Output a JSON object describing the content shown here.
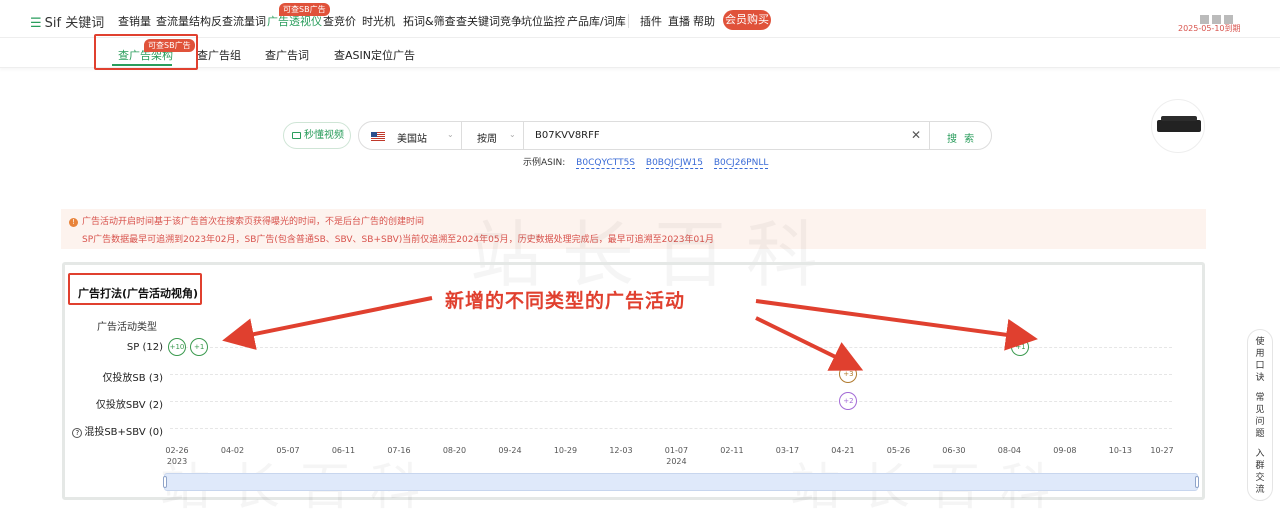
{
  "header": {
    "logo_mark": "☰",
    "logo_text": "Sif 关键词",
    "nav": [
      {
        "label": "查销量"
      },
      {
        "label": "查流量结构"
      },
      {
        "label": "反查流量词"
      },
      {
        "label": "广告透视仪",
        "active": true,
        "badge": "可查SB广告"
      },
      {
        "label": "查竞价"
      },
      {
        "label": "时光机"
      },
      {
        "label": "拓词&筛查"
      },
      {
        "label": "查关键词竞争"
      },
      {
        "label": "坑位监控"
      },
      {
        "label": "产品库/词库"
      },
      {
        "label": "插件"
      },
      {
        "label": "直播"
      },
      {
        "label": "帮助"
      }
    ],
    "buy_label": "会员购买",
    "expire_text": "2025-05-10到期"
  },
  "subnav": {
    "tabs": [
      {
        "label": "查广告架构",
        "active": true,
        "badge": "可查SB广告"
      },
      {
        "label": "查广告组"
      },
      {
        "label": "查广告词"
      },
      {
        "label": "查ASIN定位广告"
      }
    ]
  },
  "search": {
    "video_label": "秒懂视频",
    "site": "美国站",
    "period": "按周",
    "query": "B07KVV8RFF",
    "clear": "✕",
    "button": "搜 索",
    "examples_label": "示例ASIN:",
    "examples": [
      "B0CQYCTT5S",
      "B0BQJCJW15",
      "B0CJ26PNLL"
    ]
  },
  "notice": {
    "icon": "!",
    "line1": "广告活动开启时间基于该广告首次在搜索页获得曝光的时间，不是后台广告的创建时间",
    "line2": "SP广告数据最早可追溯到2023年02月，SB广告(包含普通SB、SBV、SB+SBV)当前仅追溯至2024年05月，历史数据处理完成后，最早可追溯至2023年01月"
  },
  "panel": {
    "title": "广告打法(广告活动视角)",
    "row_title": "广告活动类型",
    "rows": [
      {
        "label": "SP (12)"
      },
      {
        "label": "仅投放SB (3)"
      },
      {
        "label": "仅投放SBV (2)"
      },
      {
        "label": "混投SB+SBV (0)",
        "help": "?"
      }
    ]
  },
  "chart_data": {
    "type": "scatter",
    "x_ticks": [
      "02-26",
      "04-02",
      "05-07",
      "06-11",
      "07-16",
      "08-20",
      "09-24",
      "10-29",
      "12-03",
      "01-07",
      "02-11",
      "03-17",
      "04-21",
      "05-26",
      "06-30",
      "08-04",
      "09-08",
      "10-13",
      "10-27"
    ],
    "x_years": [
      {
        "label": "2023",
        "at": "02-26"
      },
      {
        "label": "2024",
        "at": "01-07"
      }
    ],
    "categories": [
      "SP (12)",
      "仅投放SB (3)",
      "仅投放SBV (2)",
      "混投SB+SBV (0)"
    ],
    "points": [
      {
        "row": 0,
        "tick": 0,
        "label": "+10",
        "color": "#3b9a4f"
      },
      {
        "row": 0,
        "tick": 0.4,
        "label": "+1",
        "color": "#3b9a4f"
      },
      {
        "row": 0,
        "tick": 15.2,
        "label": "+1",
        "color": "#3b9a4f"
      },
      {
        "row": 1,
        "tick": 12.1,
        "label": "+3",
        "color": "#b07a2e"
      },
      {
        "row": 2,
        "tick": 12.1,
        "label": "+2",
        "color": "#a36bd6"
      }
    ]
  },
  "callout": "新增的不同类型的广告活动",
  "watermark": "站长百科",
  "sidebar": [
    "使用口诀",
    "常见问题",
    "入群交流"
  ]
}
